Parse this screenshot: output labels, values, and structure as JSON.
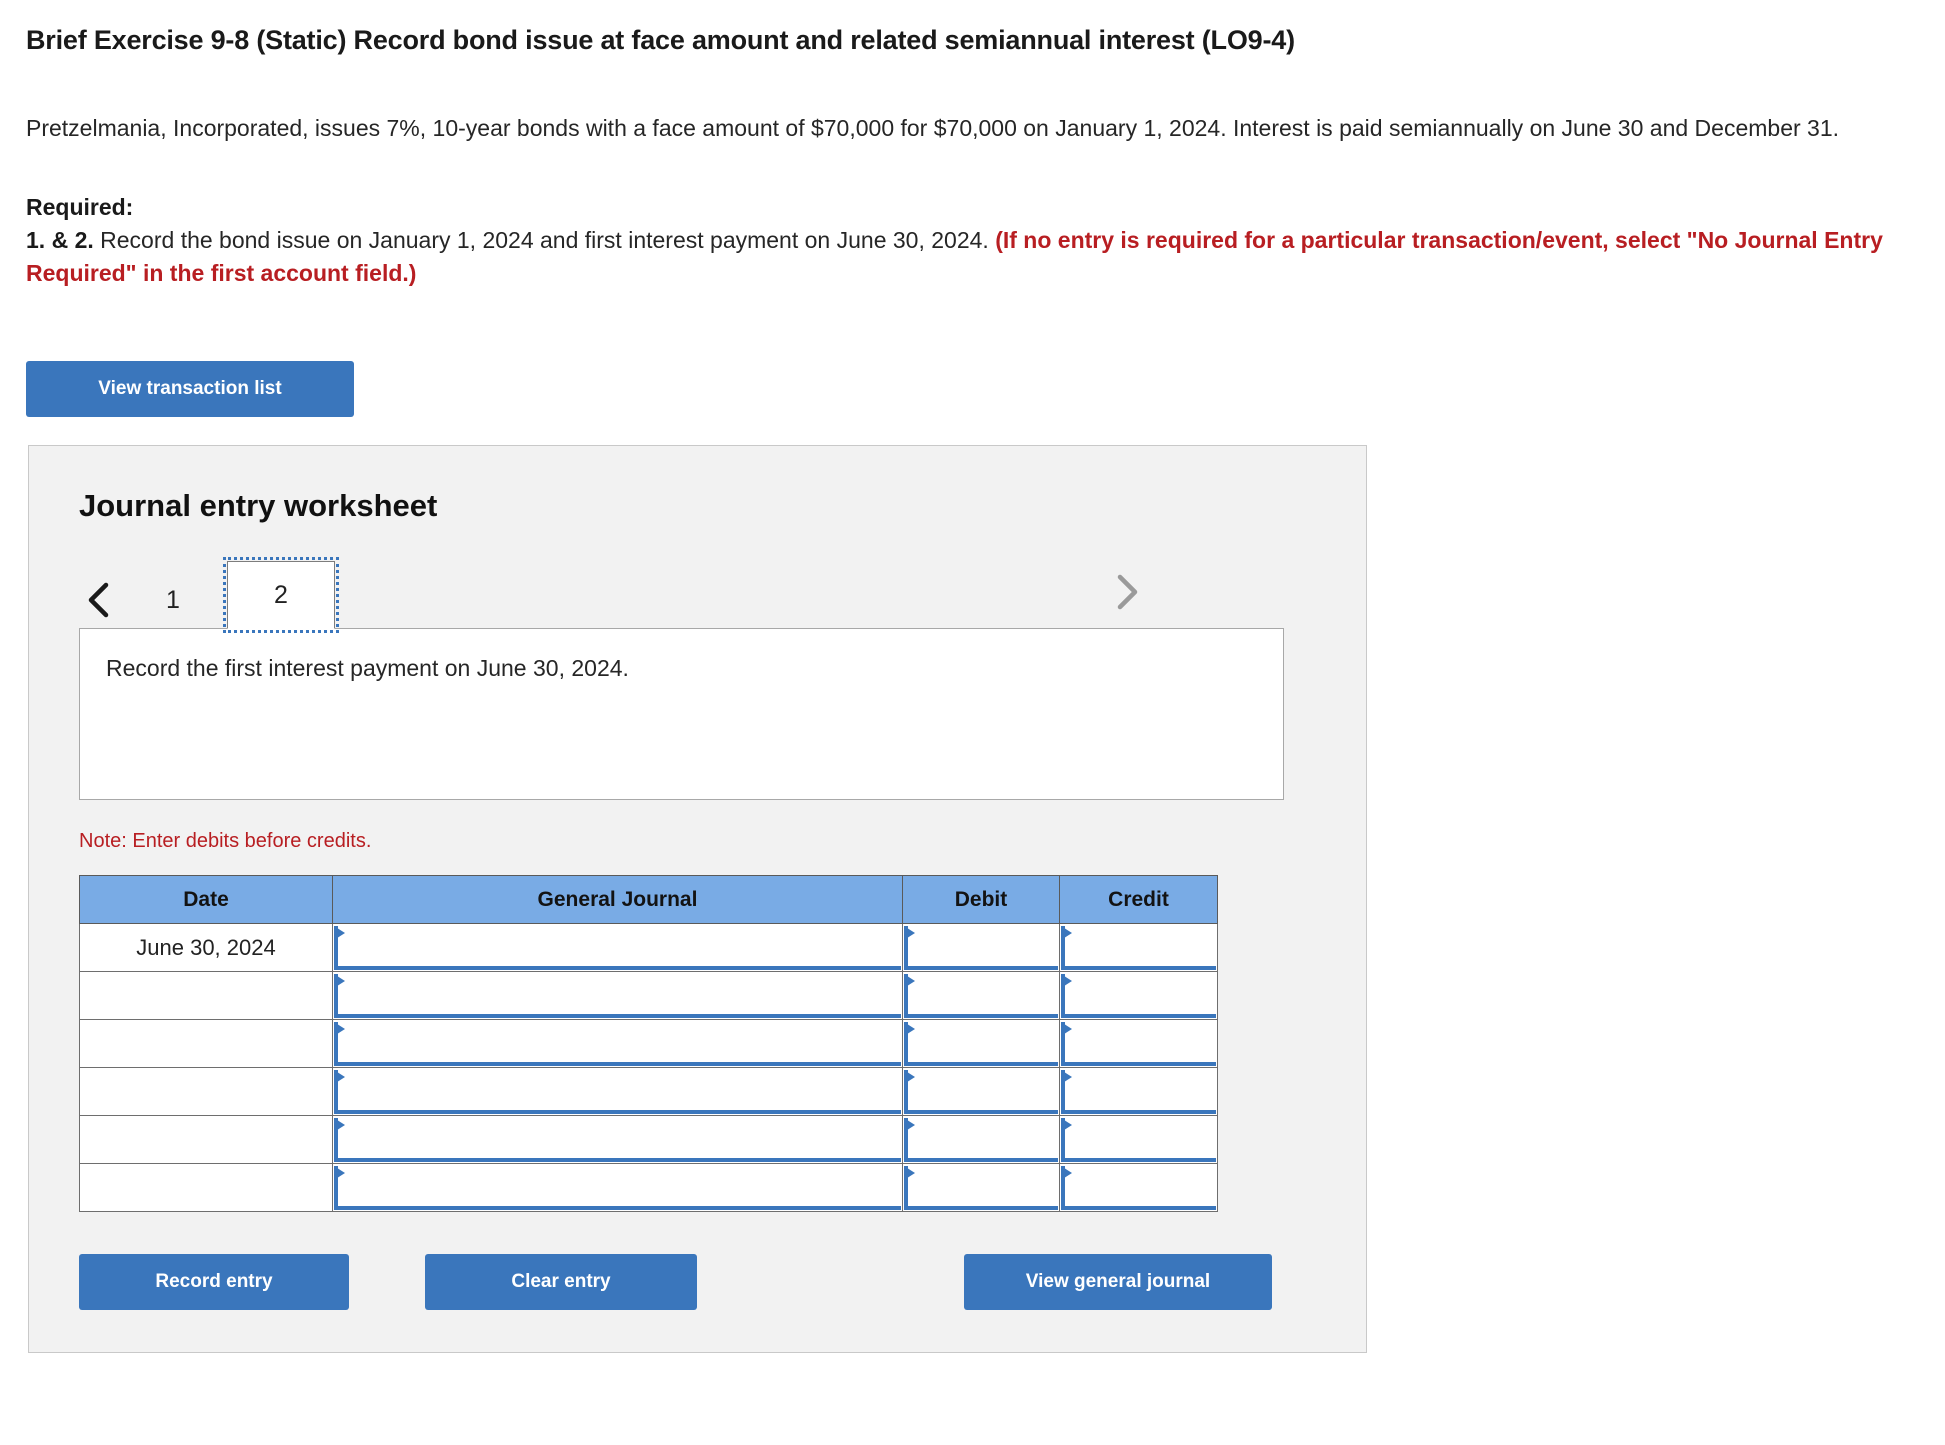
{
  "header": {
    "exercise_title": "Brief Exercise 9-8 (Static) Record bond issue at face amount and related semiannual interest (LO9-4)",
    "problem_statement": "Pretzelmania, Incorporated, issues 7%, 10-year bonds with a face amount of $70,000 for $70,000 on January 1, 2024. Interest is paid semiannually on June 30 and December 31."
  },
  "required": {
    "label": "Required:",
    "item_number": "1. & 2.",
    "item_text": " Record the bond issue on January 1, 2024 and first interest payment on June 30, 2024. ",
    "red_instruction": "(If no entry is required for a particular transaction/event, select \"No Journal Entry Required\" in the first account field.)"
  },
  "toolbar": {
    "view_transaction_list_label": "View transaction list"
  },
  "worksheet": {
    "title": "Journal entry worksheet",
    "pager": {
      "prev_icon": "chevron-left-icon",
      "next_icon": "chevron-right-icon",
      "pages": [
        {
          "label": "1",
          "active": false
        },
        {
          "label": "2",
          "active": true
        }
      ],
      "active_page": "2"
    },
    "transaction_description": "Record the first interest payment on June 30, 2024.",
    "note": "Note: Enter debits before credits.",
    "table": {
      "columns": [
        "Date",
        "General Journal",
        "Debit",
        "Credit"
      ],
      "rows": [
        {
          "date": "June 30, 2024",
          "general_journal": "",
          "debit": "",
          "credit": ""
        },
        {
          "date": "",
          "general_journal": "",
          "debit": "",
          "credit": ""
        },
        {
          "date": "",
          "general_journal": "",
          "debit": "",
          "credit": ""
        },
        {
          "date": "",
          "general_journal": "",
          "debit": "",
          "credit": ""
        },
        {
          "date": "",
          "general_journal": "",
          "debit": "",
          "credit": ""
        },
        {
          "date": "",
          "general_journal": "",
          "debit": "",
          "credit": ""
        }
      ]
    },
    "buttons": {
      "record_entry_label": "Record entry",
      "clear_entry_label": "Clear entry",
      "view_general_journal_label": "View general journal"
    }
  },
  "colors": {
    "accent_blue": "#3a76bc",
    "table_header_blue": "#79abe5",
    "warning_red": "#b81e22",
    "panel_bg": "#f2f2f2"
  }
}
